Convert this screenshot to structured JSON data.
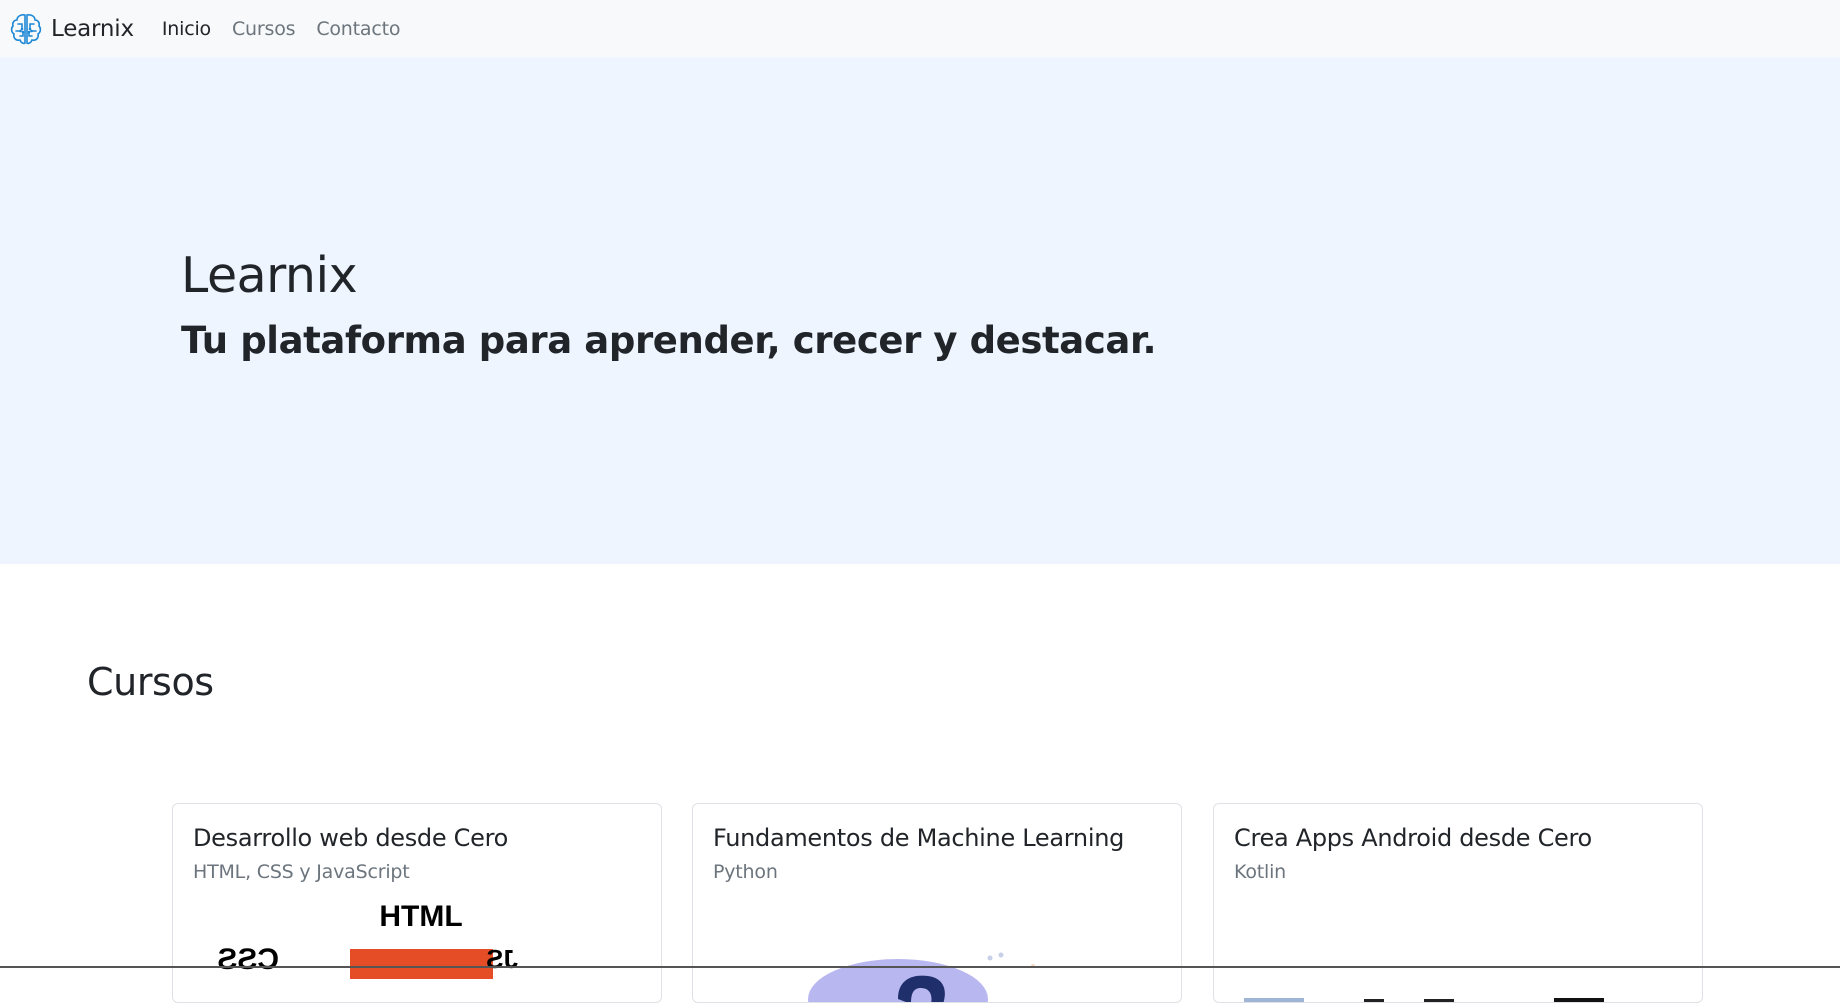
{
  "navbar": {
    "brand": "Learnix",
    "links": [
      {
        "label": "Inicio",
        "active": true
      },
      {
        "label": "Cursos",
        "active": false
      },
      {
        "label": "Contacto",
        "active": false
      }
    ]
  },
  "hero": {
    "title": "Learnix",
    "subtitle": "Tu plataforma para aprender, crecer y destacar."
  },
  "courses": {
    "section_title": "Cursos",
    "cards": [
      {
        "title": "Desarrollo web desde Cero",
        "subtitle": "HTML, CSS y JavaScript",
        "image_icon": "html-css-js-logo-icon",
        "image_text": "HTML"
      },
      {
        "title": "Fundamentos de Machine Learning",
        "subtitle": "Python",
        "image_icon": "machine-learning-illustration-icon"
      },
      {
        "title": "Crea Apps Android desde Cero",
        "subtitle": "Kotlin",
        "image_icon": "android-kotlin-illustration-icon"
      }
    ]
  },
  "colors": {
    "navbar_bg": "#f8f9fa",
    "hero_bg": "#eef5ff",
    "logo_blue": "#1e88d6",
    "html_orange": "#e44d26"
  }
}
